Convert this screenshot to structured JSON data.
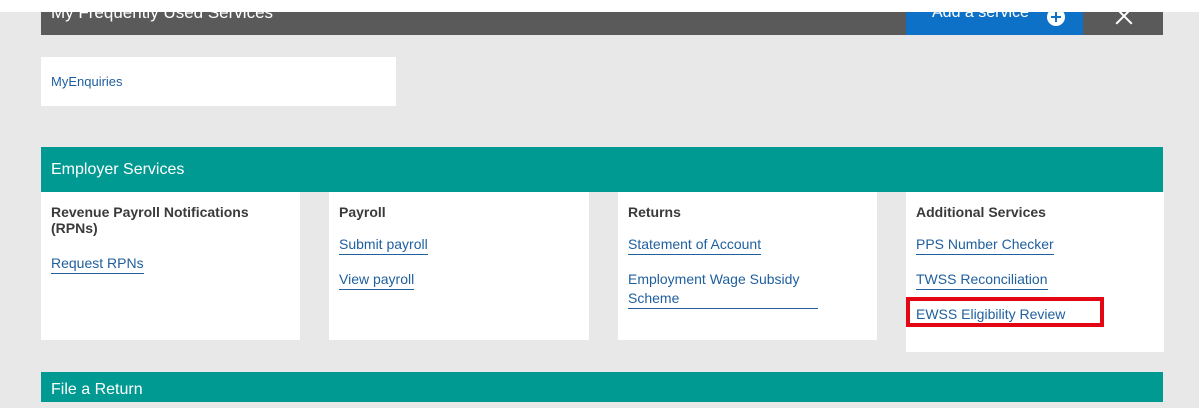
{
  "frequent": {
    "title": "My Frequently Used Services",
    "add_service_label": "Add a service",
    "enquiries_link": "MyEnquiries"
  },
  "employer_services": {
    "title": "Employer Services",
    "columns": [
      {
        "heading": "Revenue Payroll Notifications (RPNs)",
        "links": [
          "Request RPNs"
        ]
      },
      {
        "heading": "Payroll",
        "links": [
          "Submit payroll",
          "View payroll"
        ]
      },
      {
        "heading": "Returns",
        "links": [
          "Statement of Account",
          "Employment Wage Subsidy Scheme"
        ]
      },
      {
        "heading": "Additional Services",
        "links": [
          "PPS Number Checker",
          "TWSS Reconciliation",
          "EWSS Eligibility Review"
        ]
      }
    ]
  },
  "file_a_return": {
    "title": "File a Return"
  },
  "colors": {
    "teal": "#009a92",
    "dark_bar": "#5a5a5a",
    "blue_button": "#0d71c8",
    "link": "#1f5f9e",
    "highlight": "#e30613"
  }
}
